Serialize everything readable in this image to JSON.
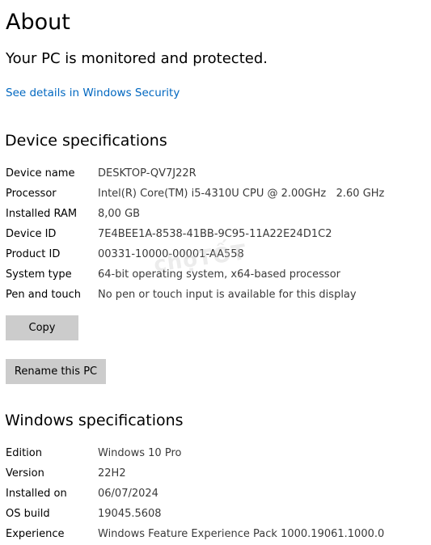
{
  "page": {
    "title": "About",
    "status": "Your PC is monitored and protected.",
    "security_link": "See details in Windows Security"
  },
  "device_specs": {
    "heading": "Device specifications",
    "rows": [
      {
        "label": "Device name",
        "value": "DESKTOP-QV7J22R"
      },
      {
        "label": "Processor",
        "value": "Intel(R) Core(TM) i5-4310U CPU @ 2.00GHz   2.60 GHz"
      },
      {
        "label": "Installed RAM",
        "value": "8,00 GB"
      },
      {
        "label": "Device ID",
        "value": "7E4BEE1A-8538-41BB-9C95-11A22E24D1C2"
      },
      {
        "label": "Product ID",
        "value": "00331-10000-00001-AA558"
      },
      {
        "label": "System type",
        "value": "64-bit operating system, x64-based processor"
      },
      {
        "label": "Pen and touch",
        "value": "No pen or touch input is available for this display"
      }
    ],
    "copy_button": "Copy",
    "rename_button": "Rename this PC"
  },
  "windows_specs": {
    "heading": "Windows specifications",
    "rows": [
      {
        "label": "Edition",
        "value": "Windows 10 Pro"
      },
      {
        "label": "Version",
        "value": "22H2"
      },
      {
        "label": "Installed on",
        "value": "06/07/2024"
      },
      {
        "label": "OS build",
        "value": "19045.5608"
      },
      {
        "label": "Experience",
        "value": "Windows Feature Experience Pack 1000.19061.1000.0"
      }
    ]
  },
  "watermark": "chợTỐT",
  "colors": {
    "link": "#0067c0",
    "button_bg": "#cccccc",
    "value_text": "#3a3a3a"
  }
}
